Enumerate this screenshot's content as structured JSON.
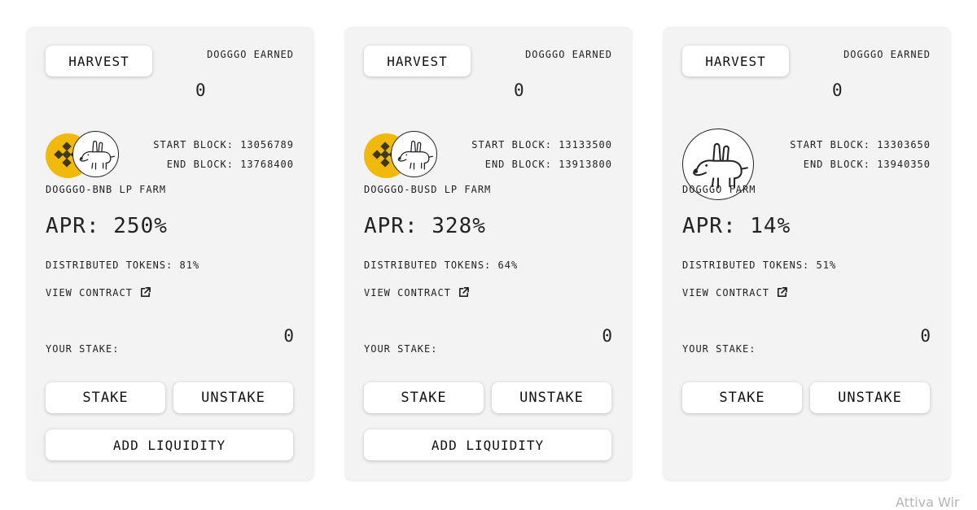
{
  "cards": [
    {
      "harvest_label": "HARVEST",
      "earned_label": "DOGGGO EARNED",
      "earned_value": "0",
      "start_block_label": "START BLOCK:",
      "start_block": "13056789",
      "end_block_label": "END BLOCK:",
      "end_block": "13768400",
      "farm_name": "DOGGGO-BNB LP FARM",
      "apr_label": "APR:",
      "apr_value": "250%",
      "distributed_label": "DISTRIBUTED TOKENS:",
      "distributed_value": "81%",
      "view_contract_label": "VIEW CONTRACT",
      "your_stake_label": "YOUR STAKE:",
      "your_stake_value": "0",
      "stake_label": "STAKE",
      "unstake_label": "UNSTAKE",
      "add_liquidity_label": "ADD LIQUIDITY",
      "pair_logo": "bnb-logo"
    },
    {
      "harvest_label": "HARVEST",
      "earned_label": "DOGGGO EARNED",
      "earned_value": "0",
      "start_block_label": "START BLOCK:",
      "start_block": "13133500",
      "end_block_label": "END BLOCK:",
      "end_block": "13913800",
      "farm_name": "DOGGGO-BUSD LP FARM",
      "apr_label": "APR:",
      "apr_value": "328%",
      "distributed_label": "DISTRIBUTED TOKENS:",
      "distributed_value": "64%",
      "view_contract_label": "VIEW CONTRACT",
      "your_stake_label": "YOUR STAKE:",
      "your_stake_value": "0",
      "stake_label": "STAKE",
      "unstake_label": "UNSTAKE",
      "add_liquidity_label": "ADD LIQUIDITY",
      "pair_logo": "busd-logo"
    },
    {
      "harvest_label": "HARVEST",
      "earned_label": "DOGGGO EARNED",
      "earned_value": "0",
      "start_block_label": "START BLOCK:",
      "start_block": "13303650",
      "end_block_label": "END BLOCK:",
      "end_block": "13940350",
      "farm_name": "DOGGGO FARM",
      "apr_label": "APR:",
      "apr_value": "14%",
      "distributed_label": "DISTRIBUTED TOKENS:",
      "distributed_value": "51%",
      "view_contract_label": "VIEW CONTRACT",
      "your_stake_label": "YOUR STAKE:",
      "your_stake_value": "0",
      "stake_label": "STAKE",
      "unstake_label": "UNSTAKE"
    }
  ],
  "watermark": "Attiva Wir",
  "colors": {
    "card_bg": "#f3f3f3",
    "token_yellow": "#f0b90b"
  }
}
